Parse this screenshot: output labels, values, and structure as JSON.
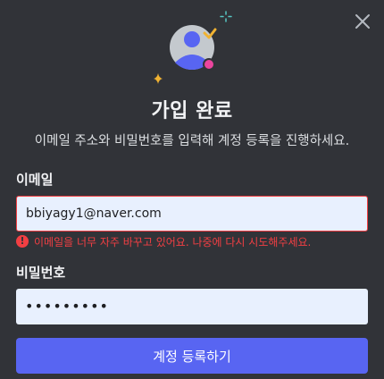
{
  "modal": {
    "title": "가입 완료",
    "subtitle": "이메일 주소와 비밀번호를 입력해 계정 등록을 진행하세요."
  },
  "email": {
    "label": "이메일",
    "value": "bbiyagy1@naver.com",
    "error": "이메일을 너무 자주 바꾸고 있어요. 나중에 다시 시도해주세요.",
    "error_icon_glyph": "!"
  },
  "password": {
    "label": "비밀번호",
    "value": "•••••••••"
  },
  "submit": {
    "label": "계정 등록하기"
  },
  "icons": {
    "close": "close-icon",
    "avatar": "avatar-illustration",
    "check": "check-icon",
    "sparkles": "sparkle-icon"
  },
  "colors": {
    "background": "#313338",
    "accent": "#5865f2",
    "error": "#f23f43",
    "input_bg": "#e8f0fe",
    "sparkle_yellow": "#f0b232",
    "sparkle_teal": "#57c7c4",
    "status_pink": "#eb459e"
  }
}
